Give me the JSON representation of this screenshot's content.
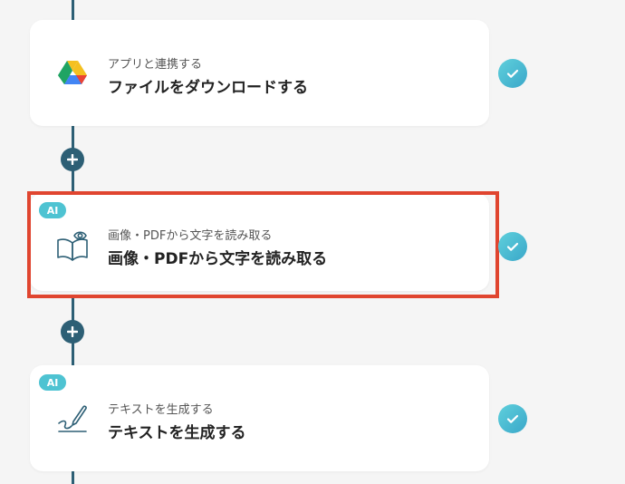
{
  "steps": [
    {
      "subtitle": "アプリと連携する",
      "title": "ファイルをダウンロードする",
      "icon": "google-drive-icon",
      "ai_badge": "",
      "status": "completed"
    },
    {
      "subtitle": "画像・PDFから文字を読み取る",
      "title": "画像・PDFから文字を読み取る",
      "icon": "book-eye-icon",
      "ai_badge": "AI",
      "status": "completed",
      "highlighted": true
    },
    {
      "subtitle": "テキストを生成する",
      "title": "テキストを生成する",
      "icon": "pen-write-icon",
      "ai_badge": "AI",
      "status": "completed"
    }
  ],
  "colors": {
    "connector": "#2d5f75",
    "ai_badge": "#4ec3d2",
    "check": "#4ec3d2",
    "highlight": "#e0452f",
    "background": "#f5f5f5"
  }
}
